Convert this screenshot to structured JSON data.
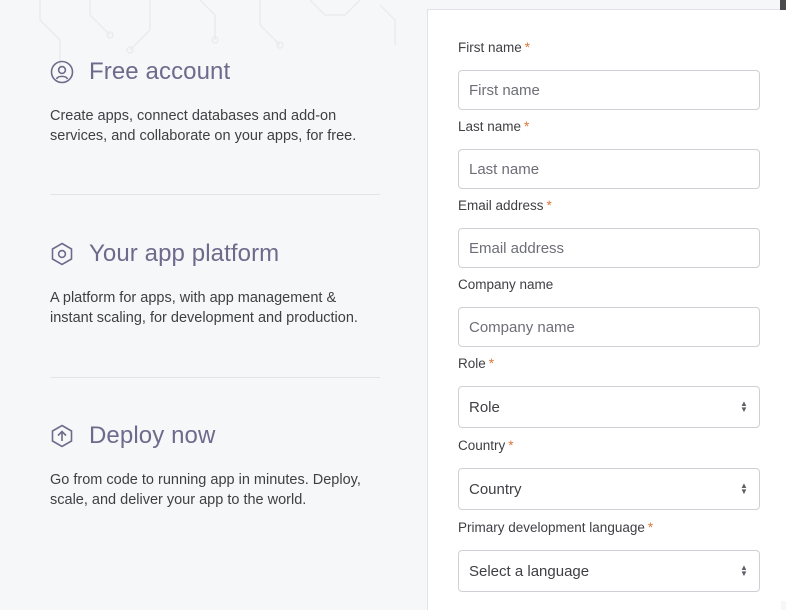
{
  "features": [
    {
      "title": "Free account",
      "icon": "user-circle-icon",
      "description": "Create apps, connect databases and add-on services, and collaborate on your apps, for free."
    },
    {
      "title": "Your app platform",
      "icon": "hexagon-icon",
      "description": "A platform for apps, with app management & instant scaling, for development and production."
    },
    {
      "title": "Deploy now",
      "icon": "upload-hexagon-icon",
      "description": "Go from code to running app in minutes. Deploy, scale, and deliver your app to the world."
    }
  ],
  "form": {
    "required_marker": "*",
    "first_name": {
      "label": "First name",
      "placeholder": "First name"
    },
    "last_name": {
      "label": "Last name",
      "placeholder": "Last name"
    },
    "email": {
      "label": "Email address",
      "placeholder": "Email address"
    },
    "company": {
      "label": "Company name",
      "placeholder": "Company name"
    },
    "role": {
      "label": "Role",
      "selected": "Role"
    },
    "country": {
      "label": "Country",
      "selected": "Country"
    },
    "language": {
      "label": "Primary development language",
      "selected": "Select a language"
    }
  },
  "colors": {
    "accent": "#6f6a8c",
    "required": "#d9773a",
    "background": "#f6f7f9",
    "border": "#cfd0d6"
  }
}
